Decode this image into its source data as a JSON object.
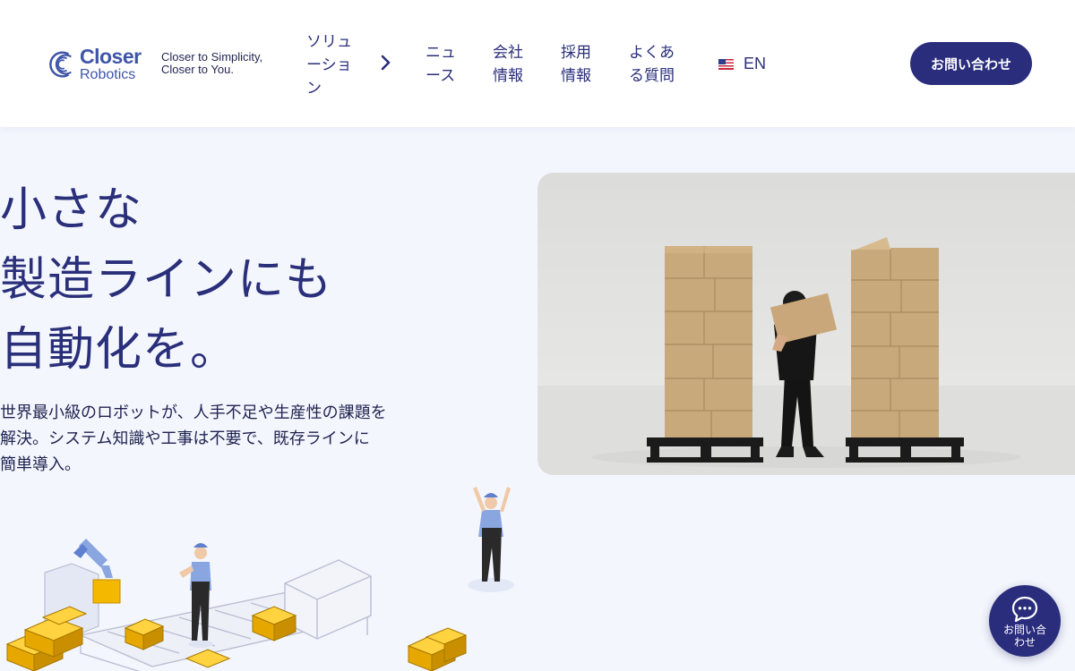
{
  "header": {
    "logo": {
      "line1": "Closer",
      "line2": "Robotics"
    },
    "tagline": [
      "Closer to Simplicity,",
      "Closer to You."
    ],
    "nav": [
      {
        "lines": [
          "ソリュ",
          "ーショ",
          "ン"
        ]
      },
      {
        "lines": [
          "ニュ",
          "ース"
        ]
      },
      {
        "lines": [
          "会社",
          "情報"
        ]
      },
      {
        "lines": [
          "採用",
          "情報"
        ]
      },
      {
        "lines": [
          "よくあ",
          "る質問"
        ]
      }
    ],
    "language": "EN",
    "contact_label": "お問い合わせ"
  },
  "hero": {
    "title_lines": [
      "小さな",
      "製造ラインにも",
      "自動化を。"
    ],
    "description_lines": [
      "世界最小級のロボットが、人手不足や生産性の課題を",
      "解決。システム知識や工事は不要で、既存ラインに",
      "簡単導入。"
    ]
  },
  "chat": {
    "label_lines": [
      "お問い合",
      "わせ"
    ]
  },
  "colors": {
    "brand": "#2a2d7c",
    "text": "#2a2f7a",
    "background": "#f4f6fd",
    "box": "#f5b800",
    "cardboard": "#c8a97c"
  },
  "icons": [
    "closer-robotics-logo",
    "chevron-right-icon",
    "us-flag-icon",
    "chat-bubble-icon"
  ]
}
